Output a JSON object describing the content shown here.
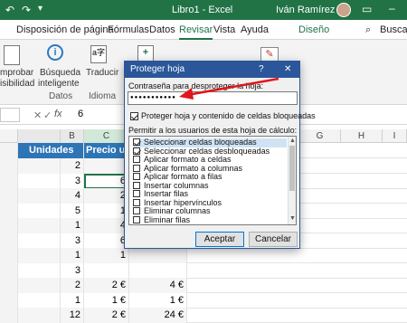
{
  "window": {
    "title": "Libro1 - Excel",
    "user": "Iván Ramírez"
  },
  "tabs": [
    "Disposición de página",
    "Fórmulas",
    "Datos",
    "Revisar",
    "Vista",
    "Ayuda",
    "Diseño"
  ],
  "search_label": "Buscar",
  "ribbon": {
    "spell_label_1": "mprobar",
    "spell_label_2": "isibilidad",
    "smart_label_1": "Búsqueda",
    "smart_label_2": "inteligente",
    "translate_label": "Traducir",
    "group_datos": "Datos",
    "group_idioma": "Idioma"
  },
  "formula_bar": {
    "name_box": "",
    "fx": "fx",
    "value": "6"
  },
  "columns": [
    "B",
    "C",
    "G",
    "H",
    "I"
  ],
  "grid": {
    "header_a": "Unidades",
    "header_c": "Precio unit",
    "rows": [
      {
        "b": "2",
        "c": "",
        "e": ""
      },
      {
        "b": "3",
        "c": "6",
        "e": ""
      },
      {
        "b": "4",
        "c": "2",
        "e": ""
      },
      {
        "b": "5",
        "c": "1",
        "e": ""
      },
      {
        "b": "1",
        "c": "4",
        "e": ""
      },
      {
        "b": "3",
        "c": "6",
        "e": ""
      },
      {
        "b": "1",
        "c": "1",
        "e": ""
      },
      {
        "b": "3",
        "c": "",
        "e": ""
      },
      {
        "b": "2",
        "c": "2 €",
        "e": "4 €"
      },
      {
        "b": "1",
        "c": "1 €",
        "e": "1 €"
      },
      {
        "b": "12",
        "c": "2 €",
        "e": "24 €"
      }
    ]
  },
  "dialog": {
    "title": "Proteger hoja",
    "help": "?",
    "close": "✕",
    "password_label": "Contraseña para desproteger la hoja:",
    "password_value": "●●●●●●●●●●●",
    "protect_label": "Proteger hoja y contenido de celdas bloqueadas",
    "allow_label": "Permitir a los usuarios de esta hoja de cálculo:",
    "items": [
      {
        "label": "Seleccionar celdas bloqueadas",
        "checked": true
      },
      {
        "label": "Seleccionar celdas desbloqueadas",
        "checked": true
      },
      {
        "label": "Aplicar formato a celdas",
        "checked": false
      },
      {
        "label": "Aplicar formato a columnas",
        "checked": false
      },
      {
        "label": "Aplicar formato a filas",
        "checked": false
      },
      {
        "label": "Insertar columnas",
        "checked": false
      },
      {
        "label": "Insertar filas",
        "checked": false
      },
      {
        "label": "Insertar hipervínculos",
        "checked": false
      },
      {
        "label": "Eliminar columnas",
        "checked": false
      },
      {
        "label": "Eliminar filas",
        "checked": false
      }
    ],
    "ok_label": "Aceptar",
    "cancel_label": "Cancelar"
  },
  "colors": {
    "excel_green": "#217346",
    "dialog_blue": "#2b579a",
    "arrow_red": "#e0161b",
    "selection": "#cfe3f5"
  }
}
